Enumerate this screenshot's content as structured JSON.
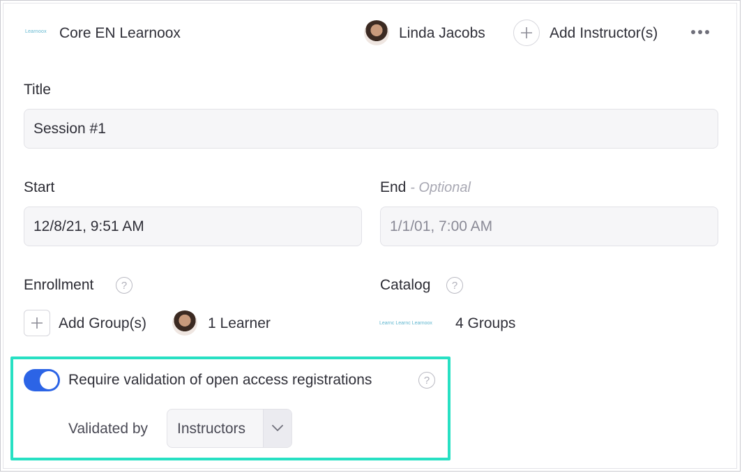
{
  "header": {
    "logo_text": "Learnoox",
    "course_name": "Core EN Learnoox",
    "instructor_name": "Linda Jacobs",
    "add_instructor_label": "Add Instructor(s)",
    "more_icon": "more-horizontal-icon"
  },
  "form": {
    "title_label": "Title",
    "title_value": "Session #1",
    "start_label": "Start",
    "start_value": "12/8/21, 9:51 AM",
    "end_label": "End",
    "end_optional": "- Optional",
    "end_placeholder": "1/1/01, 7:00 AM",
    "enrollment_label": "Enrollment",
    "add_group_label": "Add Group(s)",
    "learner_count": "1 Learner",
    "catalog_label": "Catalog",
    "catalog_logos": "Learnc Learnc Learnoox",
    "catalog_groups": "4 Groups"
  },
  "validation": {
    "toggle_on": true,
    "label": "Require validation of open access registrations",
    "validated_by_label": "Validated by",
    "validated_by_value": "Instructors"
  },
  "colors": {
    "accent": "#2c64e6",
    "highlight": "#27e0c3",
    "logo": "#5fb6cf"
  }
}
